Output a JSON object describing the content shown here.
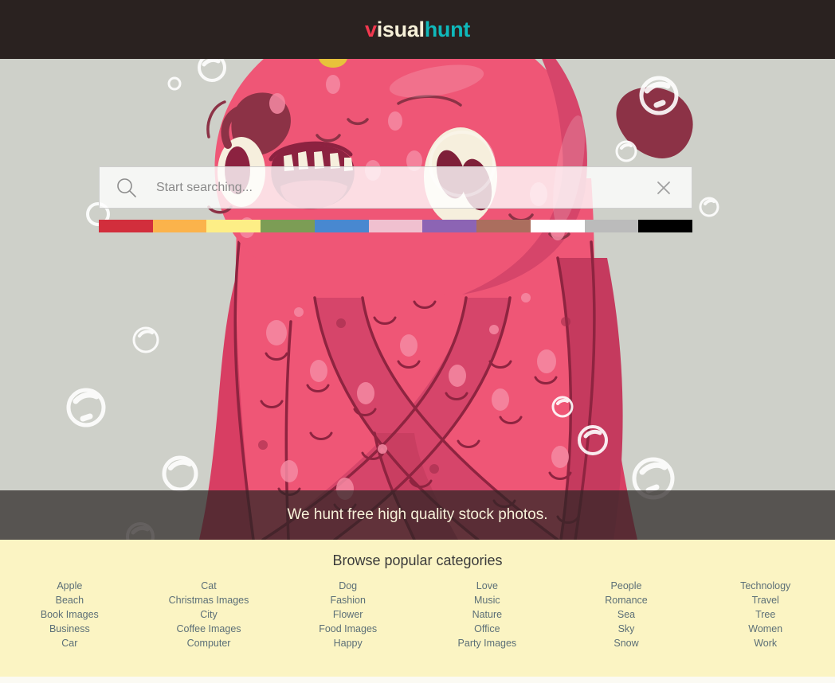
{
  "header": {
    "logo_part1": "v",
    "logo_part2": "isual",
    "logo_part3": "hunt",
    "logo_color1": "#f2394f",
    "logo_color2": "#f6f0d8",
    "logo_color3": "#0fb9bb",
    "background": "#2a2220"
  },
  "search": {
    "placeholder": "Start searching...",
    "value": "",
    "search_icon": "search-icon",
    "clear_icon": "close-icon"
  },
  "color_filters": [
    {
      "name": "red",
      "hex": "#d22e3c"
    },
    {
      "name": "orange",
      "hex": "#fbb34b"
    },
    {
      "name": "yellow",
      "hex": "#fdee86"
    },
    {
      "name": "green",
      "hex": "#7c9d55"
    },
    {
      "name": "blue",
      "hex": "#4888d0"
    },
    {
      "name": "pink",
      "hex": "#f0c0cf"
    },
    {
      "name": "purple",
      "hex": "#8c64b4"
    },
    {
      "name": "brown",
      "hex": "#ab6e5e"
    },
    {
      "name": "white",
      "hex": "#ffffff"
    },
    {
      "name": "gray",
      "hex": "#bbbbbb"
    },
    {
      "name": "black",
      "hex": "#000000"
    }
  ],
  "tagline": {
    "text": "We hunt free high quality stock photos."
  },
  "categories": {
    "title": "Browse popular categories",
    "columns": [
      {
        "items": [
          "Apple",
          "Beach",
          "Book Images",
          "Business",
          "Car"
        ]
      },
      {
        "items": [
          "Cat",
          "Christmas Images",
          "City",
          "Coffee Images",
          "Computer"
        ]
      },
      {
        "items": [
          "Dog",
          "Fashion",
          "Flower",
          "Food Images",
          "Happy"
        ]
      },
      {
        "items": [
          "Love",
          "Music",
          "Nature",
          "Office",
          "Party Images"
        ]
      },
      {
        "items": [
          "People",
          "Romance",
          "Sea",
          "Sky",
          "Snow"
        ]
      },
      {
        "items": [
          "Technology",
          "Travel",
          "Tree",
          "Women",
          "Work"
        ]
      }
    ]
  },
  "hero": {
    "background": "#ced0c9",
    "illustration": "pink-monster-illustration"
  }
}
